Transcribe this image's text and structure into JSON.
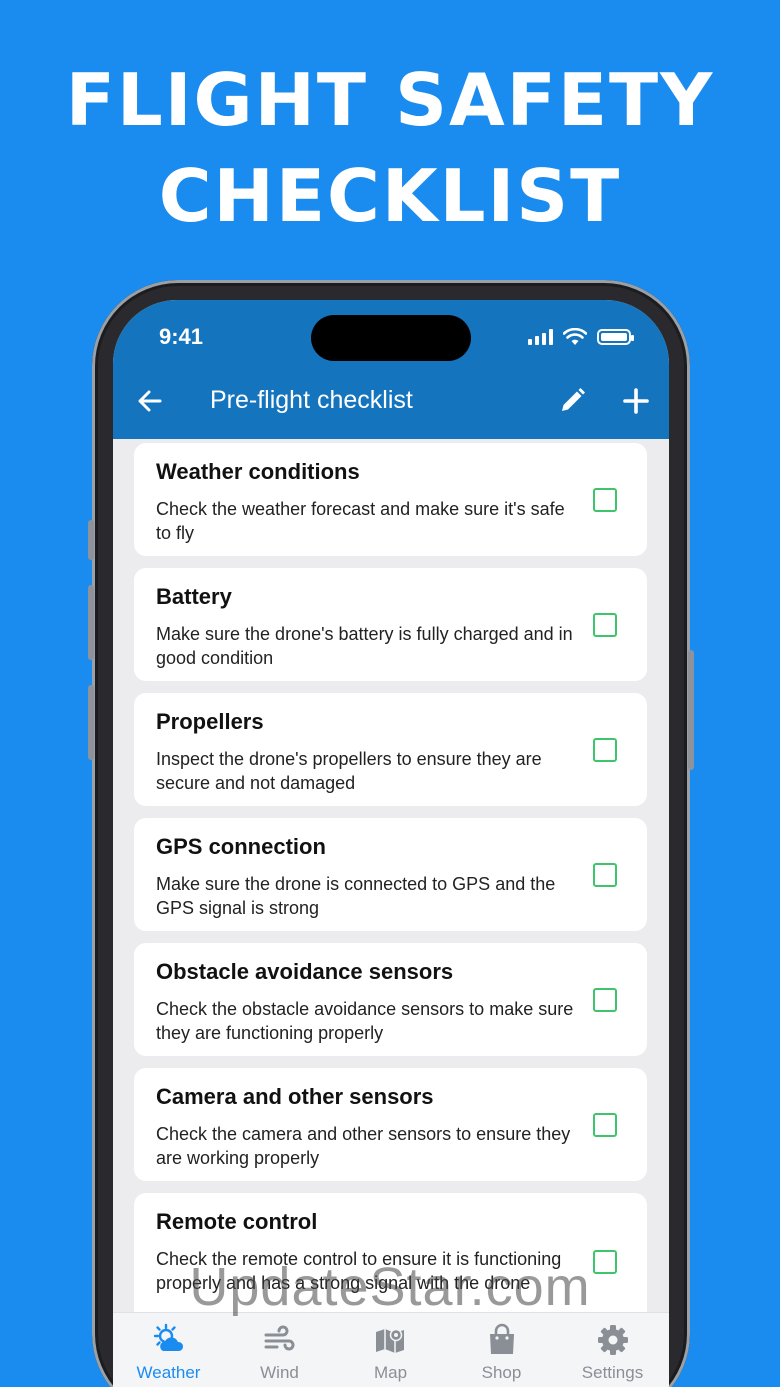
{
  "headline": {
    "line1": "FLIGHT SAFETY",
    "line2": "CHECKLIST"
  },
  "status": {
    "time": "9:41"
  },
  "appbar": {
    "title": "Pre-flight checklist"
  },
  "items": [
    {
      "title": "Weather conditions",
      "desc": "Check the weather forecast and make sure it's safe to fly",
      "checked": false
    },
    {
      "title": "Battery",
      "desc": "Make sure the drone's battery is fully charged and in good condition",
      "checked": false
    },
    {
      "title": "Propellers",
      "desc": "Inspect the drone's propellers to ensure they are secure and not damaged",
      "checked": false
    },
    {
      "title": "GPS connection",
      "desc": "Make sure the drone is connected to GPS and the GPS signal is strong",
      "checked": false
    },
    {
      "title": "Obstacle avoidance sensors",
      "desc": "Check the obstacle avoidance sensors to make sure they are functioning properly",
      "checked": false
    },
    {
      "title": "Camera and other sensors",
      "desc": "Check the camera and other sensors to ensure they are working properly",
      "checked": false
    },
    {
      "title": "Remote control",
      "desc": "Check the remote control to ensure it is functioning properly and has a strong signal with the drone",
      "checked": false
    }
  ],
  "tabs": [
    {
      "label": "Weather",
      "icon": "weather-icon",
      "active": true
    },
    {
      "label": "Wind",
      "icon": "wind-icon",
      "active": false
    },
    {
      "label": "Map",
      "icon": "map-icon",
      "active": false
    },
    {
      "label": "Shop",
      "icon": "shop-icon",
      "active": false
    },
    {
      "label": "Settings",
      "icon": "settings-icon",
      "active": false
    }
  ],
  "colors": {
    "background": "#1a8cf0",
    "appbar": "#1474bd",
    "checkbox": "#3ec46a",
    "active_tab": "#1a8cf0",
    "inactive_tab": "#8a8f96"
  },
  "watermark": "UpdateStar.com"
}
